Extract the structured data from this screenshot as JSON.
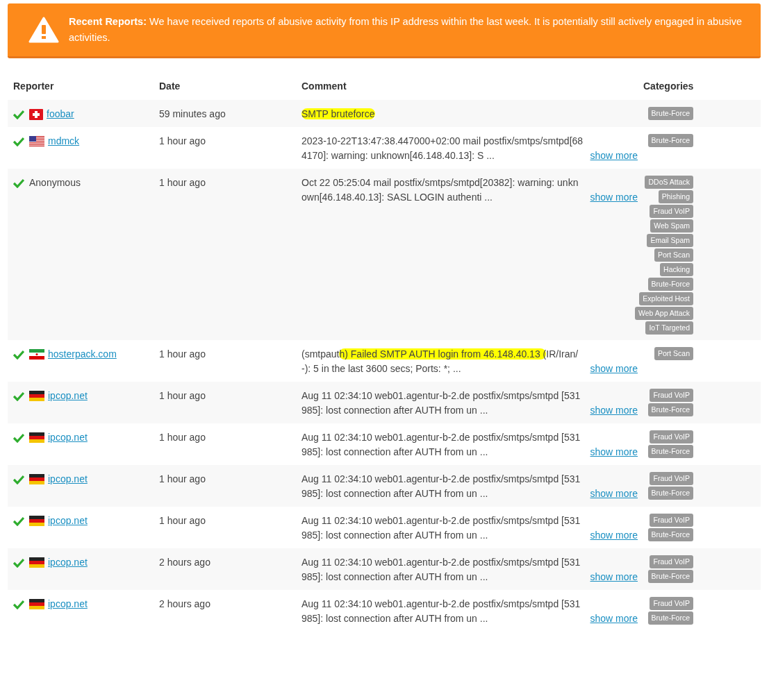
{
  "alert": {
    "title": "Recent Reports:",
    "message": "We have received reports of abusive activity from this IP address within the last week. It is potentially still actively engaged in abusive activities."
  },
  "table": {
    "columns": [
      "Reporter",
      "Date",
      "Comment",
      "Categories"
    ],
    "rows": [
      {
        "verified": true,
        "flag": {
          "kind": "ch"
        },
        "reporter": "foobar",
        "reporter_link": true,
        "date": "59 minutes ago",
        "comment": [
          {
            "text": "SMTP bruteforce",
            "highlighted": true
          }
        ],
        "show_more": null,
        "categories": [
          "Brute-Force"
        ]
      },
      {
        "verified": true,
        "flag": {
          "kind": "us"
        },
        "reporter": "mdmck",
        "reporter_link": true,
        "date": "1 hour ago",
        "comment": [
          {
            "text": "2023-10-22T13:47:38.447000+02:00 mail postfix/smtps/smtpd[684170]: warning: unknown[46.148.40.13]: S ...",
            "highlighted": false
          }
        ],
        "show_more": "show more",
        "categories": [
          "Brute-Force"
        ]
      },
      {
        "verified": true,
        "flag": null,
        "reporter": "Anonymous",
        "reporter_link": false,
        "date": "1 hour ago",
        "comment": [
          {
            "text": "Oct 22 05:25:04 mail postfix/smtps/smtpd[20382]: warning: unknown[46.148.40.13]: SASL LOGIN authenti ...",
            "highlighted": false
          }
        ],
        "show_more": "show more",
        "categories": [
          "DDoS Attack",
          "Phishing",
          "Fraud VoIP",
          "Web Spam",
          "Email Spam",
          "Port Scan",
          "Hacking",
          "Brute-Force",
          "Exploited Host",
          "Web App Attack",
          "IoT Targeted"
        ]
      },
      {
        "verified": true,
        "flag": {
          "kind": "ir"
        },
        "reporter": "hosterpack.com",
        "reporter_link": true,
        "date": "1 hour ago",
        "comment": [
          {
            "text": "(smtpaut",
            "highlighted": false
          },
          {
            "text": "h) Failed SMTP AUTH login from 46.148.40.13 (",
            "highlighted": true
          },
          {
            "text": "IR/Iran/-): 5 in the last 3600 secs; Ports: *; ...",
            "highlighted": false
          }
        ],
        "show_more": "show more",
        "categories": [
          "Port Scan"
        ]
      },
      {
        "verified": true,
        "flag": {
          "kind": "de"
        },
        "reporter": "ipcop.net",
        "reporter_link": true,
        "date": "1 hour ago",
        "comment": [
          {
            "text": "Aug 11 02:34:10 web01.agentur-b-2.de postfix/smtps/smtpd [531985]: lost connection after AUTH from un ...",
            "highlighted": false
          }
        ],
        "show_more": "show more",
        "categories": [
          "Fraud VoIP",
          "Brute-Force"
        ]
      },
      {
        "verified": true,
        "flag": {
          "kind": "de"
        },
        "reporter": "ipcop.net",
        "reporter_link": true,
        "date": "1 hour ago",
        "comment": [
          {
            "text": "Aug 11 02:34:10 web01.agentur-b-2.de postfix/smtps/smtpd [531985]: lost connection after AUTH from un ...",
            "highlighted": false
          }
        ],
        "show_more": "show more",
        "categories": [
          "Fraud VoIP",
          "Brute-Force"
        ]
      },
      {
        "verified": true,
        "flag": {
          "kind": "de"
        },
        "reporter": "ipcop.net",
        "reporter_link": true,
        "date": "1 hour ago",
        "comment": [
          {
            "text": "Aug 11 02:34:10 web01.agentur-b-2.de postfix/smtps/smtpd [531985]: lost connection after AUTH from un ...",
            "highlighted": false
          }
        ],
        "show_more": "show more",
        "categories": [
          "Fraud VoIP",
          "Brute-Force"
        ]
      },
      {
        "verified": true,
        "flag": {
          "kind": "de"
        },
        "reporter": "ipcop.net",
        "reporter_link": true,
        "date": "1 hour ago",
        "comment": [
          {
            "text": "Aug 11 02:34:10 web01.agentur-b-2.de postfix/smtps/smtpd [531985]: lost connection after AUTH from un ...",
            "highlighted": false
          }
        ],
        "show_more": "show more",
        "categories": [
          "Fraud VoIP",
          "Brute-Force"
        ]
      },
      {
        "verified": true,
        "flag": {
          "kind": "de"
        },
        "reporter": "ipcop.net",
        "reporter_link": true,
        "date": "2 hours ago",
        "comment": [
          {
            "text": "Aug 11 02:34:10 web01.agentur-b-2.de postfix/smtps/smtpd [531985]: lost connection after AUTH from un ...",
            "highlighted": false
          }
        ],
        "show_more": "show more",
        "categories": [
          "Fraud VoIP",
          "Brute-Force"
        ]
      },
      {
        "verified": true,
        "flag": {
          "kind": "de"
        },
        "reporter": "ipcop.net",
        "reporter_link": true,
        "date": "2 hours ago",
        "comment": [
          {
            "text": "Aug 11 02:34:10 web01.agentur-b-2.de postfix/smtps/smtpd [531985]: lost connection after AUTH from un ...",
            "highlighted": false
          }
        ],
        "show_more": "show more",
        "categories": [
          "Fraud VoIP",
          "Brute-Force"
        ]
      }
    ]
  }
}
